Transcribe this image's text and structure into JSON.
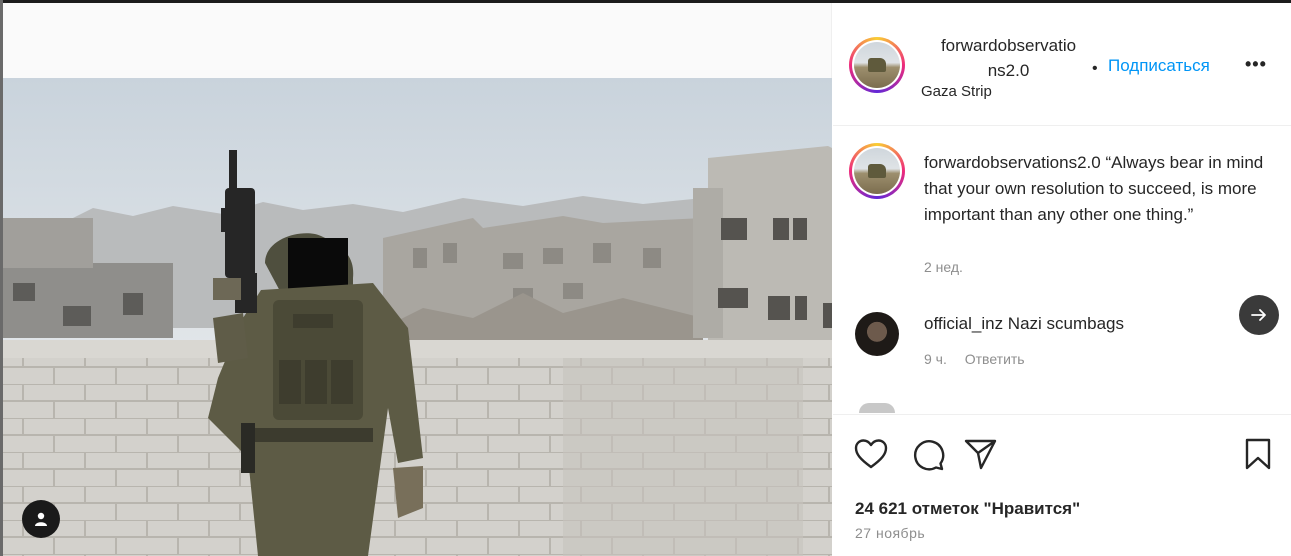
{
  "post": {
    "username_line1": "forwardobservatio",
    "username_line2": "ns2.0",
    "separator": "•",
    "follow_label": "Подписаться",
    "more_label": "•••",
    "location": "Gaza Strip"
  },
  "caption": {
    "username": "forwardobservations2.0",
    "text": " “Always bear in mind that your own resolution to succeed, is more important than any other one thing.”",
    "time": "2 нед."
  },
  "comments": [
    {
      "username": "official_inz",
      "text": " Nazi scumbags",
      "time": "9 ч.",
      "reply_label": "Ответить"
    }
  ],
  "actions": {
    "likes": "24 621 отметок \"Нравится\"",
    "date": "27 ноябрь"
  },
  "icons": {
    "like": "heart-icon",
    "comment": "comment-bubble-icon",
    "share": "paper-plane-icon",
    "save": "bookmark-icon",
    "next": "arrow-right-icon",
    "tag": "user-tag-icon",
    "more": "more-options-icon"
  },
  "colors": {
    "accent": "#0095f6",
    "text": "#262626",
    "secondary": "#8e8e8e"
  }
}
